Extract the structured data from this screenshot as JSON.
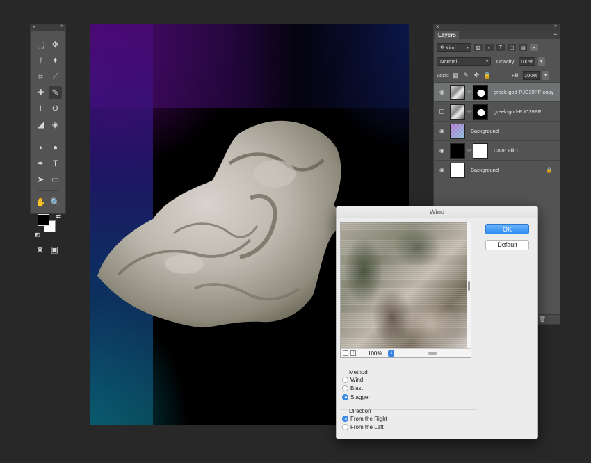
{
  "tools": {
    "close_icon": "×",
    "collapse_icon": "«",
    "items": [
      {
        "name": "marquee-tool",
        "glyph": "⬚"
      },
      {
        "name": "move-tool",
        "glyph": "✥"
      },
      {
        "name": "lasso-tool",
        "glyph": "ℓ"
      },
      {
        "name": "magic-wand-tool",
        "glyph": "✦"
      },
      {
        "name": "crop-tool",
        "glyph": "⌗"
      },
      {
        "name": "eyedropper-tool",
        "glyph": "⟋"
      },
      {
        "name": "healing-brush-tool",
        "glyph": "✚"
      },
      {
        "name": "brush-tool",
        "glyph": "✎"
      },
      {
        "name": "clone-stamp-tool",
        "glyph": "⊥"
      },
      {
        "name": "history-brush-tool",
        "glyph": "↺"
      },
      {
        "name": "eraser-tool",
        "glyph": "◪"
      },
      {
        "name": "paint-bucket-tool",
        "glyph": "◈"
      },
      {
        "name": "blur-tool",
        "glyph": "◗"
      },
      {
        "name": "dodge-tool",
        "glyph": "●"
      },
      {
        "name": "pen-tool",
        "glyph": "✒"
      },
      {
        "name": "type-tool",
        "glyph": "T"
      },
      {
        "name": "path-selection-tool",
        "glyph": "➤"
      },
      {
        "name": "rectangle-tool",
        "glyph": "▭"
      },
      {
        "name": "hand-tool",
        "glyph": "✋"
      },
      {
        "name": "zoom-tool",
        "glyph": "🔍"
      }
    ]
  },
  "colors": {
    "foreground": "#000000",
    "background": "#ffffff",
    "accent": "#3c8ff1",
    "panel": "#535353"
  },
  "layers_panel": {
    "tab": "Layers",
    "filter_label": "Kind",
    "blend_mode": "Normal",
    "opacity_label": "Opacity:",
    "opacity_value": "100%",
    "lock_label": "Lock:",
    "fill_label": "Fill:",
    "fill_value": "100%",
    "layers": [
      {
        "name": "greek-god-PJC39PF copy",
        "visible": true,
        "selected": true
      },
      {
        "name": "greek-god-PJC39PF",
        "visible": false,
        "selected": false
      },
      {
        "name": "Background",
        "visible": true,
        "selected": false
      },
      {
        "name": "Color Fill 1",
        "visible": true,
        "selected": false
      },
      {
        "name": "Background",
        "visible": true,
        "selected": false,
        "locked": true
      }
    ]
  },
  "wind_dialog": {
    "title": "Wind",
    "ok_label": "OK",
    "default_label": "Default",
    "zoom_value": "100%",
    "method": {
      "label": "Method",
      "options": [
        "Wind",
        "Blast",
        "Stagger"
      ],
      "selected": "Stagger"
    },
    "direction": {
      "label": "Direction",
      "options": [
        "From the Right",
        "From the Left"
      ],
      "selected": "From the Right"
    }
  }
}
